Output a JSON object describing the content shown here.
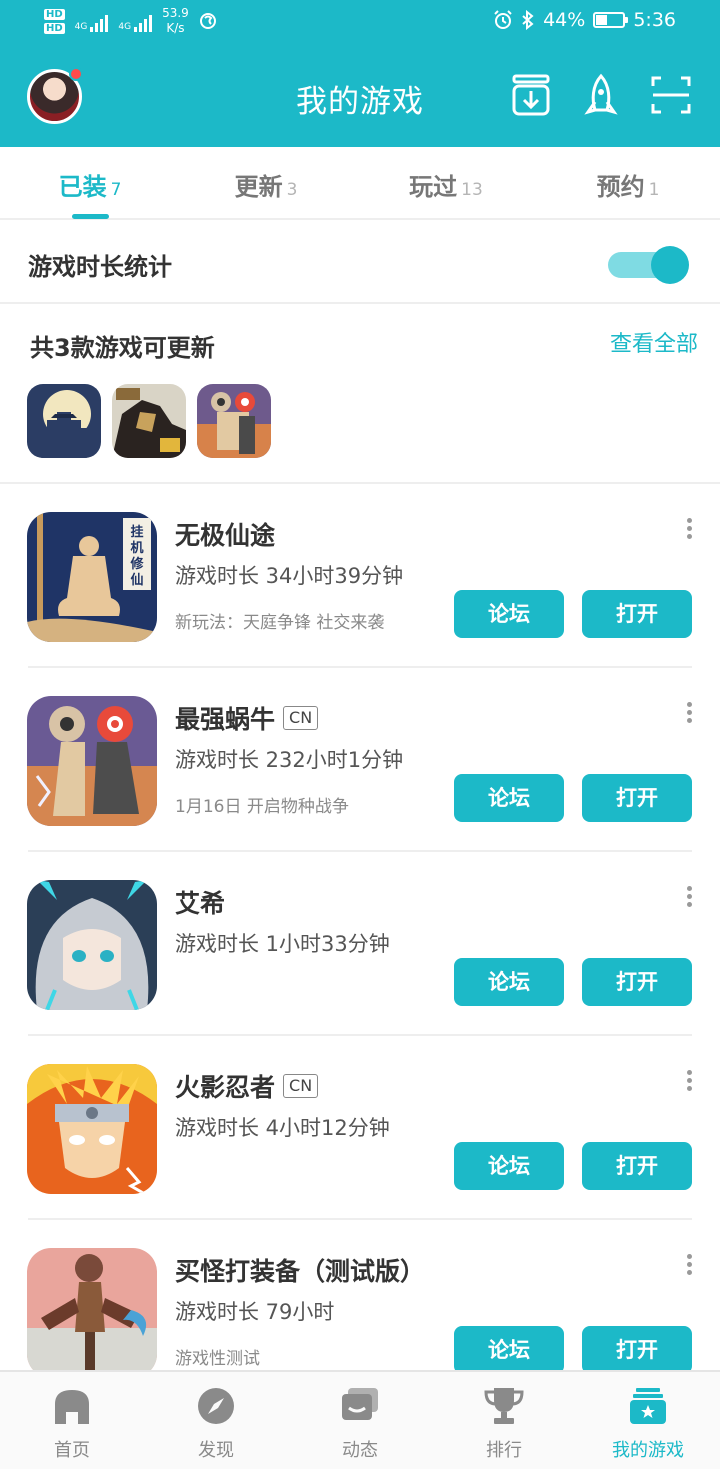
{
  "status_bar": {
    "hd1": "HD",
    "hd2": "HD",
    "net1": "4G",
    "net2": "4G",
    "speed_value": "53.9",
    "speed_unit": "K/s",
    "battery_text": "44%",
    "battery_level": 0.44,
    "time": "5:36"
  },
  "header": {
    "title": "我的游戏",
    "icons": [
      "download-manager-icon",
      "rocket-icon",
      "scan-icon"
    ]
  },
  "tabs": [
    {
      "label": "已装",
      "count": "7",
      "active": true
    },
    {
      "label": "更新",
      "count": "3",
      "active": false
    },
    {
      "label": "玩过",
      "count": "13",
      "active": false
    },
    {
      "label": "预约",
      "count": "1",
      "active": false
    }
  ],
  "stats": {
    "label": "游戏时长统计",
    "enabled": true
  },
  "updates": {
    "title": "共3款游戏可更新",
    "view_all": "查看全部"
  },
  "games": [
    {
      "name": "无极仙途",
      "tag": "",
      "playtime": "游戏时长 34小时39分钟",
      "note": "新玩法：天庭争锋 社交来袭",
      "forum": "论坛",
      "open": "打开"
    },
    {
      "name": "最强蜗牛",
      "tag": "CN",
      "playtime": "游戏时长 232小时1分钟",
      "note": "1月16日 开启物种战争",
      "forum": "论坛",
      "open": "打开"
    },
    {
      "name": "艾希",
      "tag": "",
      "playtime": "游戏时长 1小时33分钟",
      "note": "",
      "forum": "论坛",
      "open": "打开"
    },
    {
      "name": "火影忍者",
      "tag": "CN",
      "playtime": "游戏时长 4小时12分钟",
      "note": "",
      "forum": "论坛",
      "open": "打开"
    },
    {
      "name": "买怪打装备（测试版）",
      "tag": "",
      "playtime": "游戏时长 79小时",
      "note": "游戏性测试",
      "forum": "论坛",
      "open": "打开"
    }
  ],
  "bottom_nav": [
    {
      "label": "首页",
      "icon": "home-icon",
      "active": false
    },
    {
      "label": "发现",
      "icon": "compass-icon",
      "active": false
    },
    {
      "label": "动态",
      "icon": "chat-icon",
      "active": false
    },
    {
      "label": "排行",
      "icon": "trophy-icon",
      "active": false
    },
    {
      "label": "我的游戏",
      "icon": "my-games-icon",
      "active": true
    }
  ],
  "colors": {
    "accent": "#1cb9c8",
    "accent_light": "#7fdbe3",
    "badge_red": "#ff4b4b",
    "text_dark": "#333333",
    "text_muted": "#8a8a8a"
  }
}
